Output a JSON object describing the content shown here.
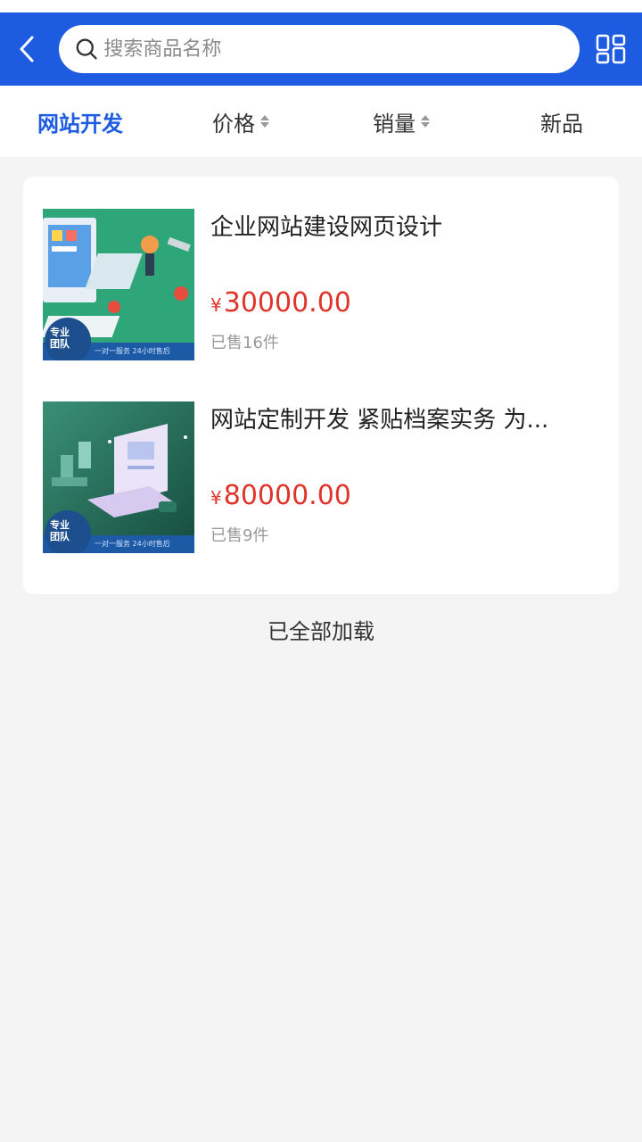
{
  "search": {
    "placeholder": "搜索商品名称"
  },
  "filters": [
    {
      "label": "网站开发"
    },
    {
      "label": "价格"
    },
    {
      "label": "销量"
    },
    {
      "label": "新品"
    }
  ],
  "products": [
    {
      "title": "企业网站建设网页设计",
      "currency": "¥",
      "price": "30000.00",
      "sold": "已售16件",
      "badge_line1": "专业",
      "badge_line2": "团队",
      "banner": "一对一服务 24小时售后",
      "colors": {
        "bg": "#2fa67a"
      }
    },
    {
      "title": "网站定制开发 紧贴档案实务 为...",
      "currency": "¥",
      "price": "80000.00",
      "sold": "已售9件",
      "badge_line1": "专业",
      "badge_line2": "团队",
      "banner": "一对一服务 24小时售后",
      "colors": {
        "bg": "#1f6a56"
      }
    }
  ],
  "footer": {
    "all_loaded": "已全部加载"
  },
  "colors": {
    "brand": "#1d5be0",
    "price": "#e0342b"
  }
}
